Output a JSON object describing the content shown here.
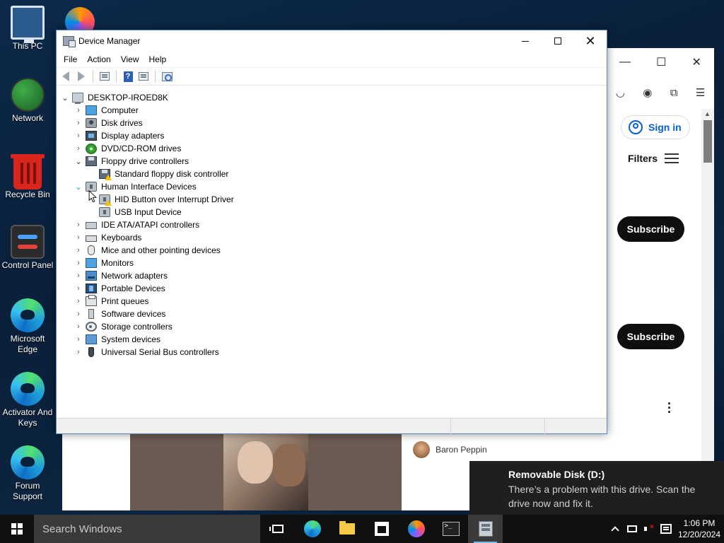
{
  "desktop": {
    "icons": [
      {
        "label": "This PC"
      },
      {
        "label": "Network"
      },
      {
        "label": "Recycle Bin"
      },
      {
        "label": "Control Panel"
      },
      {
        "label": "Microsoft Edge"
      },
      {
        "label": "Activator And Keys"
      },
      {
        "label": "Forum Support"
      }
    ]
  },
  "browser": {
    "sign_in_label": "Sign in",
    "filters_label": "Filters",
    "subscribe_label_1": "Subscribe",
    "subscribe_label_2": "Subscribe",
    "commenter_name": "Baron Peppin",
    "titlebar_glyphs": {
      "minimize": "—",
      "maximize": "☐",
      "close": "✕"
    }
  },
  "device_manager": {
    "title": "Device Manager",
    "menu": [
      "File",
      "Action",
      "View",
      "Help"
    ],
    "root": "DESKTOP-IROED8K",
    "tree": [
      {
        "label": "Computer",
        "icon": "monitor-icon",
        "expanded": false
      },
      {
        "label": "Disk drives",
        "icon": "disk-icon",
        "expanded": false
      },
      {
        "label": "Display adapters",
        "icon": "display-adapter-icon",
        "expanded": false
      },
      {
        "label": "DVD/CD-ROM drives",
        "icon": "dvd-icon",
        "expanded": false
      },
      {
        "label": "Floppy drive controllers",
        "icon": "floppy-icon",
        "expanded": true
      },
      {
        "label": "Standard floppy disk controller",
        "icon": "floppy-warning-icon",
        "child": true
      },
      {
        "label": "Human Interface Devices",
        "icon": "hid-icon",
        "expanded": true
      },
      {
        "label": "HID Button over Interrupt Driver",
        "icon": "hid-warning-icon",
        "child": true
      },
      {
        "label": "USB Input Device",
        "icon": "hid-icon",
        "child": true
      },
      {
        "label": "IDE ATA/ATAPI controllers",
        "icon": "ide-icon",
        "expanded": false
      },
      {
        "label": "Keyboards",
        "icon": "keyboard-icon",
        "expanded": false
      },
      {
        "label": "Mice and other pointing devices",
        "icon": "mouse-icon",
        "expanded": false
      },
      {
        "label": "Monitors",
        "icon": "monitor-icon",
        "expanded": false
      },
      {
        "label": "Network adapters",
        "icon": "network-adapter-icon",
        "expanded": false
      },
      {
        "label": "Portable Devices",
        "icon": "portable-device-icon",
        "expanded": false
      },
      {
        "label": "Print queues",
        "icon": "printer-icon",
        "expanded": false
      },
      {
        "label": "Software devices",
        "icon": "software-device-icon",
        "expanded": false
      },
      {
        "label": "Storage controllers",
        "icon": "storage-controller-icon",
        "expanded": false
      },
      {
        "label": "System devices",
        "icon": "system-device-icon",
        "expanded": false
      },
      {
        "label": "Universal Serial Bus controllers",
        "icon": "usb-icon",
        "expanded": false
      }
    ]
  },
  "toast": {
    "title": "Removable Disk (D:)",
    "body": "There’s a problem with this drive.  Scan the drive now and fix it."
  },
  "taskbar": {
    "search_placeholder": "Search Windows",
    "time": "1:06 PM",
    "date": "12/20/2024"
  },
  "colors": {
    "accent": "#0078d7",
    "warning": "#f2c200",
    "subscribe_bg": "#0f0f0f",
    "signin_blue": "#065fd4"
  }
}
